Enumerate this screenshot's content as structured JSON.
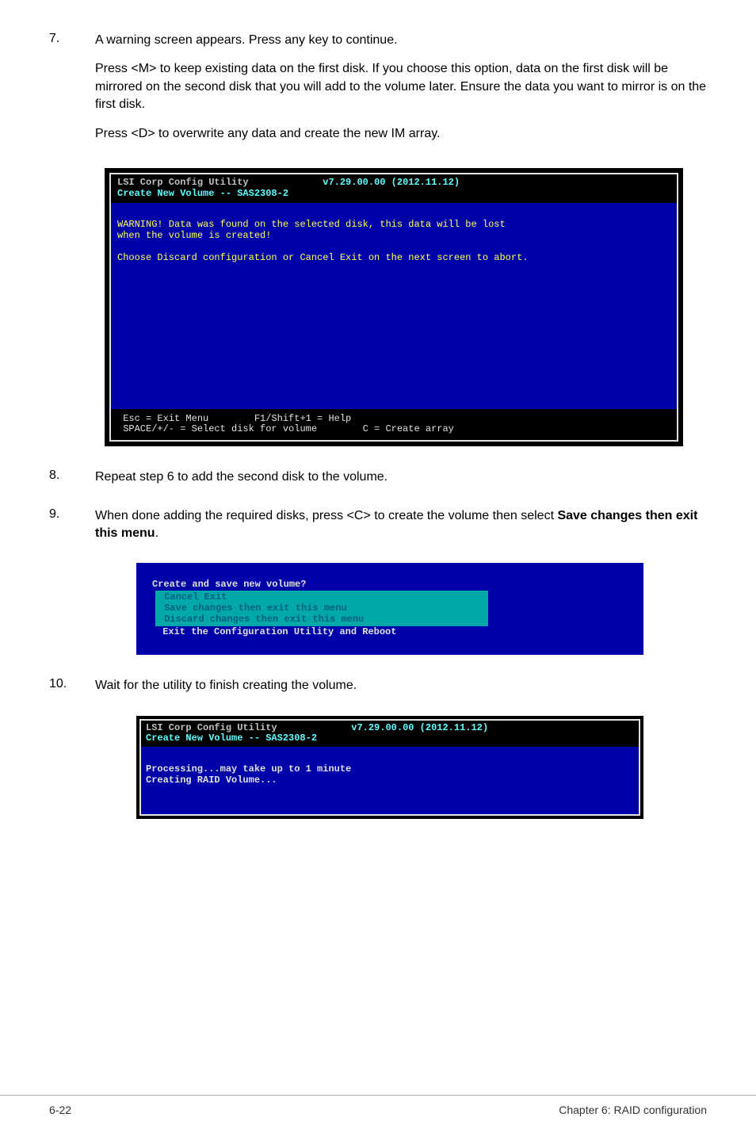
{
  "steps": {
    "s7": {
      "num": "7.",
      "p1": "A warning screen appears. Press any key to continue.",
      "p2": "Press <M> to keep existing data on the first disk. If you choose this option, data on the first disk will be mirrored on the second disk that you will add to the volume later. Ensure the data you want to mirror is on the first disk.",
      "p3": "Press <D> to overwrite any data and create the new IM array."
    },
    "s8": {
      "num": "8.",
      "p1": "Repeat step 6 to add the second disk to the volume."
    },
    "s9": {
      "num": "9.",
      "p1_a": "When done adding the required disks, press <C> to create the volume then select ",
      "p1_b": "Save changes then exit this menu",
      "p1_c": "."
    },
    "s10": {
      "num": "10.",
      "p1": "Wait for the utility to finish creating the volume."
    }
  },
  "bios1": {
    "hdr_a": "LSI Corp Config Utility",
    "hdr_ver": "             v7.29.00.00 (2012.11.12)",
    "hdr_b": "Create New Volume -- SAS2308-2",
    "body_l1": "WARNING! Data was found on the selected disk, this data will be lost",
    "body_l2": "when the volume is created!",
    "body_l3": "Choose Discard configuration or Cancel Exit on the next screen to abort.",
    "footer_l1": " Esc = Exit Menu        F1/Shift+1 = Help",
    "footer_l2": " SPACE/+/- = Select disk for volume        C = Create array"
  },
  "bios2": {
    "title": "Create and save new volume?",
    "m1": " Cancel Exit",
    "m2": " Save changes then exit this menu",
    "m3": " Discard changes then exit this menu",
    "reboot": " Exit the Configuration Utility and Reboot"
  },
  "bios3": {
    "hdr_a": "LSI Corp Config Utility",
    "hdr_ver": "             v7.29.00.00 (2012.11.12)",
    "hdr_b": "Create New Volume -- SAS2308-2",
    "body_l1": "Processing...may take up to 1 minute",
    "body_l2": "Creating RAID Volume..."
  },
  "footer": {
    "left": "6-22",
    "right": "Chapter 6: RAID configuration"
  }
}
